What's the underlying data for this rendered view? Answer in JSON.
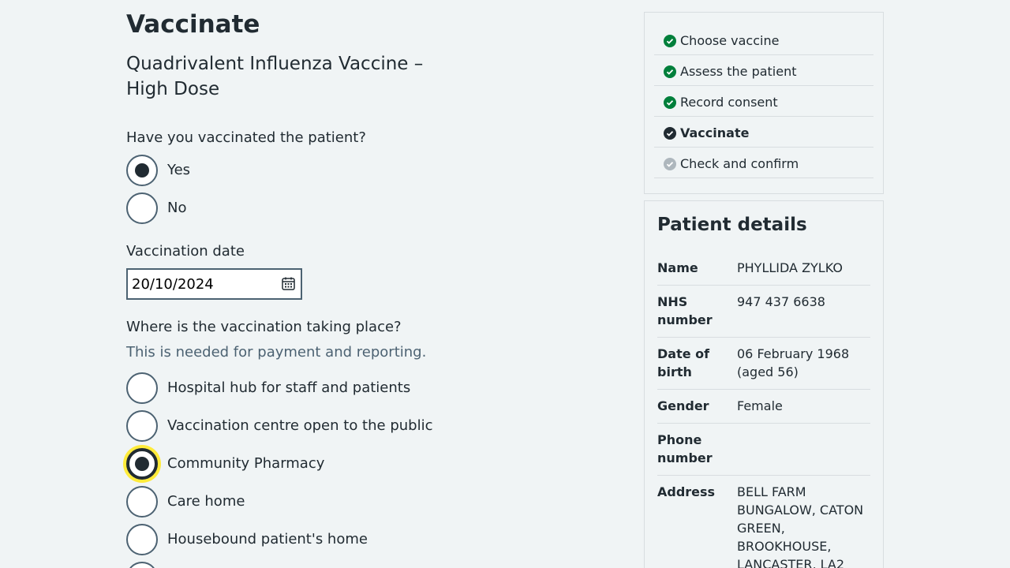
{
  "page": {
    "title": "Vaccinate",
    "vaccine": "Quadrivalent Influenza Vaccine – High Dose"
  },
  "vaccinated": {
    "question": "Have you vaccinated the patient?",
    "options": [
      {
        "label": "Yes",
        "checked": true
      },
      {
        "label": "No",
        "checked": false
      }
    ]
  },
  "date": {
    "label": "Vaccination date",
    "value": "20/10/2024"
  },
  "location": {
    "question": "Where is the vaccination taking place?",
    "hint": "This is needed for payment and reporting.",
    "options": [
      {
        "label": "Hospital hub for staff and patients",
        "checked": false
      },
      {
        "label": "Vaccination centre open to the public",
        "checked": false
      },
      {
        "label": "Community Pharmacy",
        "checked": true
      },
      {
        "label": "Care home",
        "checked": false
      },
      {
        "label": "Housebound patient's home",
        "checked": false
      }
    ]
  },
  "steps": [
    {
      "label": "Choose vaccine",
      "status": "complete"
    },
    {
      "label": "Assess the patient",
      "status": "complete"
    },
    {
      "label": "Record consent",
      "status": "complete"
    },
    {
      "label": "Vaccinate",
      "status": "current"
    },
    {
      "label": "Check and confirm",
      "status": "upcoming"
    }
  ],
  "patient": {
    "title": "Patient details",
    "rows": [
      {
        "key": "Name",
        "value": "PHYLLIDA ZYLKO"
      },
      {
        "key": "NHS number",
        "value": "947 437 6638"
      },
      {
        "key": "Date of birth",
        "value": "06 February 1968 (aged 56)"
      },
      {
        "key": "Gender",
        "value": "Female"
      },
      {
        "key": "Phone number",
        "value": ""
      },
      {
        "key": "Address",
        "value": "BELL FARM BUNGALOW, CATON GREEN, BROOKHOUSE, LANCASTER, LA2"
      }
    ]
  },
  "colors": {
    "complete": "#007f3b",
    "current": "#212b32",
    "upcoming": "#aeb7bd",
    "focus": "#ffeb3b"
  }
}
